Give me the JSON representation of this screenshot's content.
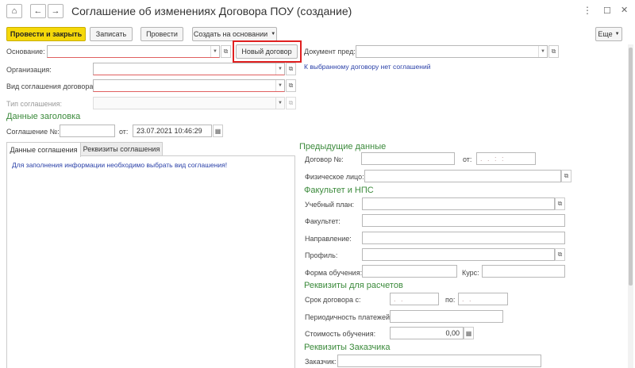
{
  "window": {
    "title": "Соглашение об изменениях Договора ПОУ (создание)",
    "menu_icon": "⋮",
    "maximize_icon": "☐",
    "close_icon": "✕"
  },
  "toolbar": {
    "post_close": "Провести и закрыть",
    "save": "Записать",
    "post": "Провести",
    "create_based": "Создать на основании",
    "more": "Еще"
  },
  "header_fields": {
    "basis_label": "Основание:",
    "basis_value": "",
    "new_contract_button": "Новый договор",
    "prev_doc_label": "Документ пред:",
    "prev_doc_value": "",
    "no_agreements_hint": "К выбранному договору нет соглашений",
    "org_label": "Организация:",
    "org_value": "",
    "agreement_kind_label": "Вид соглашения договора:",
    "agreement_kind_value": "",
    "agreement_type_label": "Тип соглашения:",
    "agreement_type_value": ""
  },
  "header_data": {
    "section_title": "Данные заголовка",
    "agreement_no_label": "Соглашение №:",
    "agreement_no_value": "",
    "from_label": "от:",
    "date_value": "23.07.2021 10:46:29"
  },
  "tabs": {
    "tab1": "Данные соглашения",
    "tab2": "Реквизиты соглашения",
    "fill_hint": "Для заполнения информации необходимо выбрать вид соглашения!"
  },
  "previous_data": {
    "section_title": "Предыдущие данные",
    "contract_no_label": "Договор №:",
    "contract_no_value": "",
    "from_label": "от:",
    "from_value": ". .   : :",
    "person_label": "Физическое лицо:",
    "person_value": ""
  },
  "faculty": {
    "section_title": "Факультет и НПС",
    "plan_label": "Учебный план:",
    "faculty_label": "Факультет:",
    "direction_label": "Направление:",
    "profile_label": "Профиль:",
    "form_label": "Форма обучения:",
    "course_label": "Курс:"
  },
  "payments": {
    "section_title": "Реквизиты для расчетов",
    "term_from_label": "Срок договора с:",
    "term_from_value": ". .",
    "to_label": "по:",
    "term_to_value": ". .",
    "periodicity_label": "Периодичность платежей:",
    "cost_label": "Стоимость обучения:",
    "cost_value": "0,00"
  },
  "customer": {
    "section_title": "Реквизиты Заказчика",
    "customer_label": "Заказчик:"
  }
}
